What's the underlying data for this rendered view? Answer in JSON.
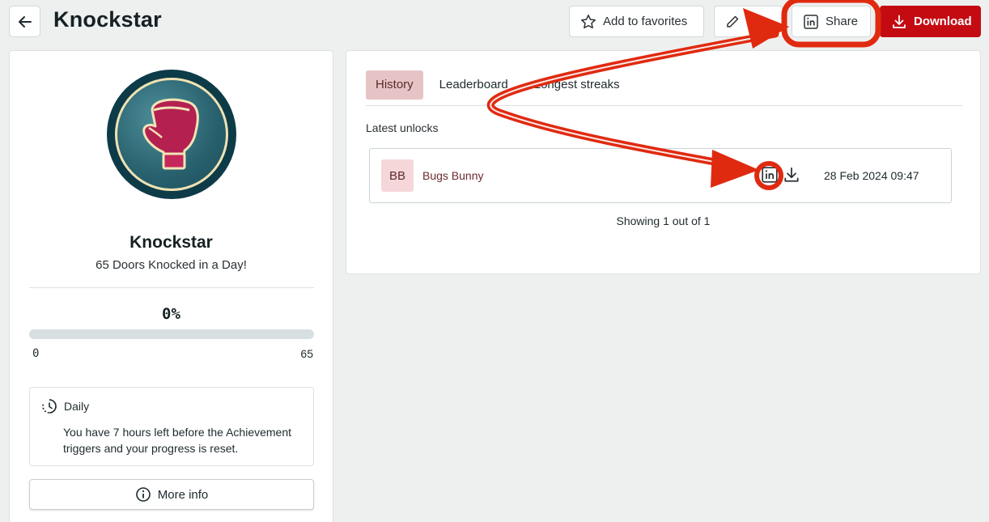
{
  "header": {
    "title": "Knockstar",
    "favorites_label": "Add to favorites",
    "share_label": "Share",
    "download_label": "Download"
  },
  "achievement": {
    "name": "Knockstar",
    "description": "65 Doors Knocked in a Day!",
    "progress_text": "0%",
    "progress_fraction": 0,
    "min": "0",
    "max": "65",
    "schedule_label": "Daily",
    "schedule_info": "You have 7 hours left before the Achievement triggers and your progress is reset.",
    "more_info_label": "More info"
  },
  "tabs": [
    {
      "label": "History",
      "active": true
    },
    {
      "label": "Leaderboard",
      "active": false
    },
    {
      "label": "Longest streaks",
      "active": false
    }
  ],
  "history": {
    "section_label": "Latest unlocks",
    "rows": [
      {
        "initials": "BB",
        "name": "Bugs Bunny",
        "date": "28 Feb 2024 09:47"
      }
    ],
    "footer": "Showing 1 out of 1"
  },
  "icons": {
    "back": "arrow-left-icon",
    "favorites": "star-icon",
    "edit": "pencil-icon",
    "share": "linkedin-icon",
    "download": "download-icon",
    "schedule": "clock-icon",
    "info": "info-icon"
  },
  "colors": {
    "accent": "#c40b12",
    "annotation": "#e02a10",
    "tab_active_bg": "#e6c4c6",
    "avatar_bg": "#f5d7da",
    "badge_ring": "#0e3b48"
  }
}
